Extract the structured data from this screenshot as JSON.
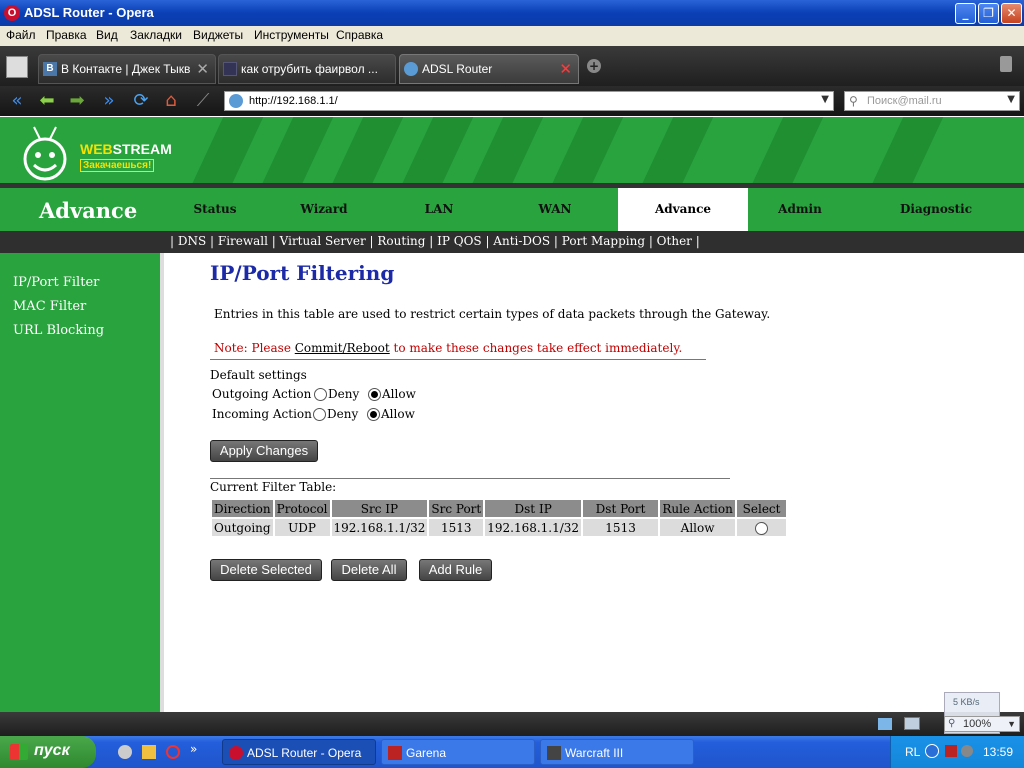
{
  "window": {
    "title": "ADSL Router - Opera",
    "controls": {
      "minimize": "_",
      "maximize": "❐",
      "close": "✕"
    }
  },
  "menubar": [
    "Файл",
    "Правка",
    "Вид",
    "Закладки",
    "Виджеты",
    "Инструменты",
    "Справка"
  ],
  "tabs": [
    {
      "label": "В Контакте | Джек Тыкв",
      "icon": "vk-icon",
      "active": false
    },
    {
      "label": "как отрубить фаирвол ...",
      "icon": "page-icon",
      "active": false
    },
    {
      "label": "ADSL Router",
      "icon": "globe-icon",
      "active": true
    }
  ],
  "address": {
    "url": "http://192.168.1.1/"
  },
  "search": {
    "placeholder": "Поиск@mail.ru"
  },
  "router": {
    "brand_web": "WEB",
    "brand_stream": "STREAM",
    "tagline": "Закачаешься!",
    "section": "Advance",
    "nav": [
      {
        "label": "Status",
        "active": false
      },
      {
        "label": "Wizard",
        "active": false
      },
      {
        "label": "LAN",
        "active": false
      },
      {
        "label": "WAN",
        "active": false
      },
      {
        "label": "Advance",
        "active": true
      },
      {
        "label": "Admin",
        "active": false
      },
      {
        "label": "Diagnostic",
        "active": false
      }
    ],
    "subnav": "| DNS | Firewall | Virtual Server | Routing | IP QOS | Anti-DOS | Port Mapping | Other |",
    "sidebar": [
      "IP/Port Filter",
      "MAC Filter",
      "URL Blocking"
    ],
    "content": {
      "title": "IP/Port Filtering",
      "description": "Entries in this table are used to restrict certain types of data packets through the Gateway.",
      "note_prefix": "Note: Please ",
      "note_link": "Commit/Reboot",
      "note_suffix": " to make these changes take effect immediately.",
      "default_settings": "Default settings",
      "outgoing_label": "Outgoing Action",
      "incoming_label": "Incoming Action",
      "deny": "Deny",
      "allow": "Allow",
      "outgoing_value": "Allow",
      "incoming_value": "Allow",
      "apply_button": "Apply Changes",
      "table_title": "Current Filter Table:",
      "table_headers": [
        "Direction",
        "Protocol",
        "Src IP",
        "Src Port",
        "Dst IP",
        "Dst Port",
        "Rule Action",
        "Select"
      ],
      "table_rows": [
        [
          "Outgoing",
          "UDP",
          "192.168.1.1/32",
          "1513",
          "192.168.1.1/32",
          "1513",
          "Allow"
        ]
      ],
      "buttons": {
        "delete_selected": "Delete Selected",
        "delete_all": "Delete All",
        "add_rule": "Add Rule"
      }
    }
  },
  "statusbar": {
    "speed": "5 KB/s",
    "zoom": "100%"
  },
  "taskbar": {
    "start": "пуск",
    "items": [
      {
        "label": "ADSL Router - Opera",
        "active": true
      },
      {
        "label": "Garena",
        "active": false
      },
      {
        "label": "Warcraft III",
        "active": false
      }
    ],
    "lang": "RL",
    "time": "13:59"
  },
  "colors": {
    "router_green": "#29a33e",
    "title_blue": "#1c2aa8",
    "note_red": "#c00000"
  }
}
